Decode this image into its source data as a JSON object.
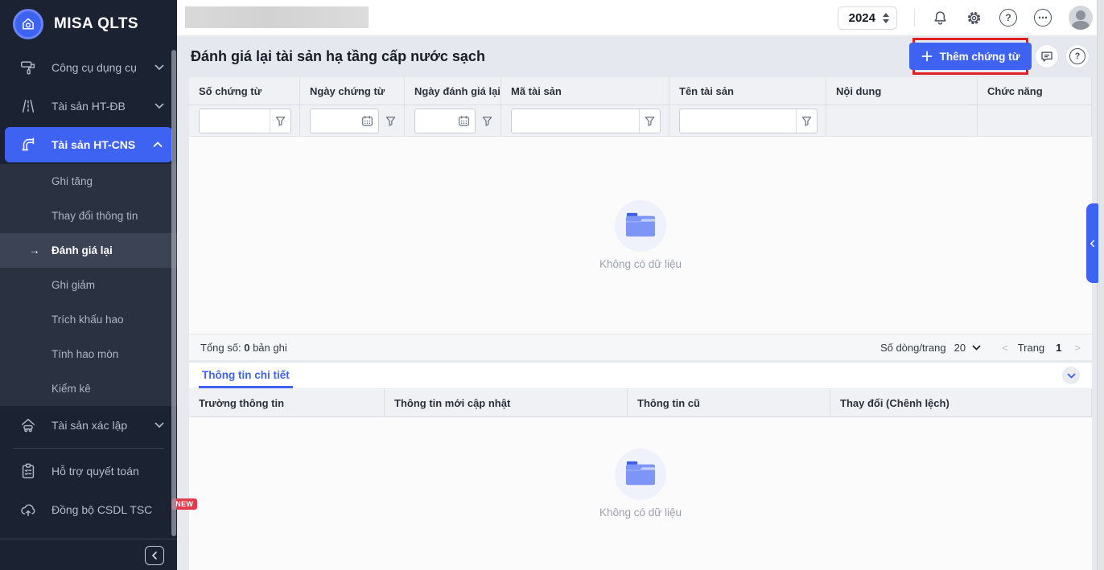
{
  "colors": {
    "accent_blue": "#3E63F2",
    "annotation_red": "#E02020",
    "badge_red": "#E23B4E",
    "sidebar_bg": "#1B2232"
  },
  "brand": {
    "name": "MISA QLTS"
  },
  "sidebar": {
    "main_items": [
      {
        "label": "Công cụ dụng cụ"
      },
      {
        "label": "Tài sản HT-ĐB"
      },
      {
        "label": "Tài sản HT-CNS"
      }
    ],
    "submenu": {
      "active_arrow": "→",
      "items": [
        {
          "label": "Ghi tăng"
        },
        {
          "label": "Thay đổi thông tin"
        },
        {
          "label": "Đánh giá lại"
        },
        {
          "label": "Ghi giảm"
        },
        {
          "label": "Trích khấu hao"
        },
        {
          "label": "Tính hao mòn"
        },
        {
          "label": "Kiểm kê"
        }
      ]
    },
    "lower_items": [
      {
        "label": "Tài sản xác lập"
      },
      {
        "label": "Hỗ trợ quyết toán"
      },
      {
        "label": "Đồng bộ CSDL TSC",
        "badge": "NEW"
      }
    ]
  },
  "topbar": {
    "year": "2024",
    "icon_glyphs": {
      "help": "?",
      "more": "⋯"
    }
  },
  "page": {
    "title": "Đánh giá lại tài sản hạ tầng cấp nước sạch",
    "add_button_label": "Thêm chứng từ",
    "help_glyph": "?"
  },
  "table": {
    "columns": [
      {
        "label": "Số chứng từ"
      },
      {
        "label": "Ngày chứng từ"
      },
      {
        "label": "Ngày đánh giá lại"
      },
      {
        "label": "Mã tài sản"
      },
      {
        "label": "Tên tài sản"
      },
      {
        "label": "Nội dung"
      },
      {
        "label": "Chức năng"
      }
    ],
    "empty_text": "Không có dữ liệu",
    "footer": {
      "total_label": "Tổng số:",
      "total_value": "0",
      "total_unit": "bản ghi",
      "rows_per_page_label": "Số dòng/trang",
      "rows_per_page_value": "20",
      "prev": "<",
      "page_label": "Trang",
      "page_value": "1",
      "next": ">"
    }
  },
  "detail": {
    "tab_label": "Thông tin chi tiết",
    "columns": [
      {
        "label": "Trường thông tin"
      },
      {
        "label": "Thông tin mới cập nhật"
      },
      {
        "label": "Thông tin cũ"
      },
      {
        "label": "Thay đổi (Chênh lệch)"
      }
    ],
    "empty_text": "Không có dữ liệu"
  }
}
